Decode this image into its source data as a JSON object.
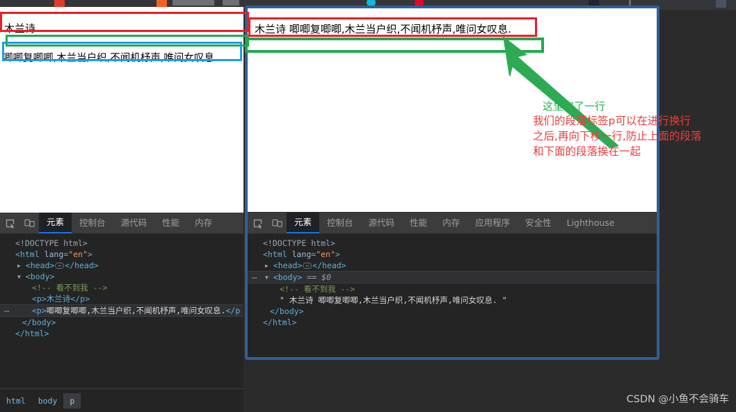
{
  "page": {
    "left_window": {
      "line1": "木兰诗",
      "line2": "唧唧复唧唧,木兰当户织,不闻机杼声,唯问女叹息."
    },
    "right_window": {
      "line1": "木兰诗 唧唧复唧唧,木兰当户织,不闻机杼声,唯问女叹息."
    }
  },
  "annotation": {
    "green_note": "这里空了一行",
    "red_lines": [
      "我们的段落标签p可以在进行换行",
      "之后,再向下移一行,防止上面的段落",
      "和下面的段落挨在一起"
    ],
    "colors": {
      "red_box": "#ee1c25",
      "green_box": "#1faa52",
      "blue_box": "#18a0e8",
      "arrow": "#2eaa54",
      "green_text": "#25b14c",
      "red_text": "#ef3b3b"
    }
  },
  "devtools_left": {
    "icons": [
      "inspect-element-icon",
      "device-toolbar-icon"
    ],
    "tabs": [
      {
        "label": "元素",
        "active": true
      },
      {
        "label": "控制台",
        "active": false
      },
      {
        "label": "源代码",
        "active": false
      },
      {
        "label": "性能",
        "active": false
      },
      {
        "label": "内存",
        "active": false
      }
    ],
    "dom": {
      "doctype": "<!DOCTYPE html>",
      "html_open_tag": "<html",
      "lang_attr_name": "lang",
      "lang_attr_value": "\"en\"",
      "head_open": "<head>",
      "head_close": "</head>",
      "body_open": "<body>",
      "comment": "<!-- 看不到我 -->",
      "p1": "<p>木兰诗</p>",
      "p2_open": "<p>",
      "p2_text": "唧唧复唧唧,木兰当户织,不闻机杼声,唯问女叹息.",
      "p2_close": "</p",
      "body_close": "</body>",
      "html_close": "</html>"
    }
  },
  "devtools_right": {
    "icons": [
      "inspect-element-icon",
      "device-toolbar-icon"
    ],
    "tabs": [
      {
        "label": "元素",
        "active": true
      },
      {
        "label": "控制台",
        "active": false
      },
      {
        "label": "源代码",
        "active": false
      },
      {
        "label": "性能",
        "active": false
      },
      {
        "label": "内存",
        "active": false
      },
      {
        "label": "应用程序",
        "active": false
      },
      {
        "label": "安全性",
        "active": false
      },
      {
        "label": "Lighthouse",
        "active": false
      }
    ],
    "dom": {
      "doctype": "<!DOCTYPE html>",
      "html_open_tag": "<html",
      "lang_attr_name": "lang",
      "lang_attr_value": "\"en\"",
      "head_open": "<head>",
      "head_close": "</head>",
      "body_open": "<body>",
      "body_selected_marker": "== $0",
      "comment": "<!-- 看不到我 -->",
      "text_node": "\" 木兰诗 唧唧复唧唧,木兰当户织,不闻机杼声,唯问女叹息. \"",
      "body_close": "</body>",
      "html_close": "</html>"
    }
  },
  "breadcrumb": {
    "items": [
      {
        "label": "html",
        "current": false
      },
      {
        "label": "body",
        "current": false
      },
      {
        "label": "p",
        "current": true
      }
    ]
  },
  "watermark": {
    "text": "CSDN @小鱼不会骑车"
  }
}
